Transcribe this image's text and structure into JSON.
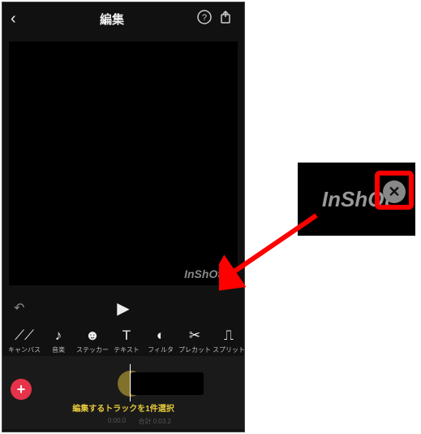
{
  "header": {
    "title": "編集",
    "back_icon": "‹",
    "help_icon": "?",
    "share_icon": "⤴"
  },
  "watermark": {
    "text": "InShOt",
    "close": "✕"
  },
  "playbar": {
    "undo": "↶",
    "play": "▶"
  },
  "tools": [
    {
      "icon": "⟋⟋",
      "label": "キャンバス"
    },
    {
      "icon": "♪",
      "label": "音楽"
    },
    {
      "icon": "☻",
      "label": "ステッカー"
    },
    {
      "icon": "T",
      "label": "テキスト"
    },
    {
      "icon": "◐",
      "label": "フィルタ"
    },
    {
      "icon": "✂",
      "label": "プレカット"
    },
    {
      "icon": "⎍",
      "label": "スプリット"
    }
  ],
  "timeline": {
    "add": "+",
    "prompt": "編集するトラックを1件選択",
    "current_time": "0:00.0",
    "total_label": "合計",
    "total_time": "0:03.2"
  },
  "callout": {
    "watermark": "InShOt",
    "close": "✕"
  }
}
